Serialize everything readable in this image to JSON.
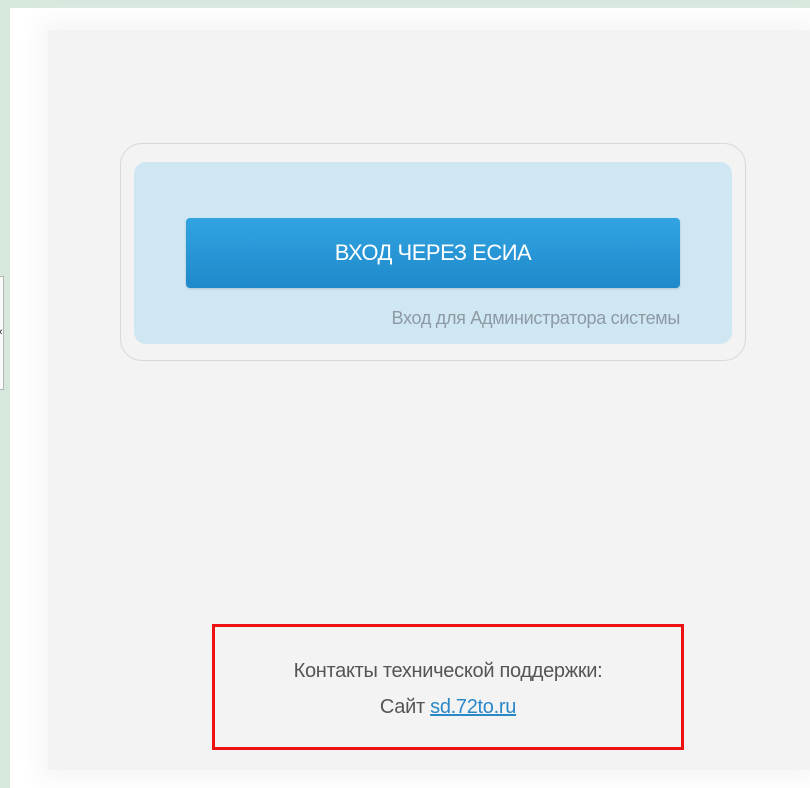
{
  "login": {
    "esia_button_label": "ВХОД ЧЕРЕЗ ЕСИА",
    "admin_link_label": "Вход для Администратора системы"
  },
  "support": {
    "title": "Контакты технической поддержки:",
    "site_prefix": "Сайт",
    "site_link": "sd.72to.ru"
  },
  "colors": {
    "button": "#1f89ca",
    "panel": "#cfe6f3",
    "highlight_border": "#ee1111",
    "link": "#2b88c7"
  }
}
